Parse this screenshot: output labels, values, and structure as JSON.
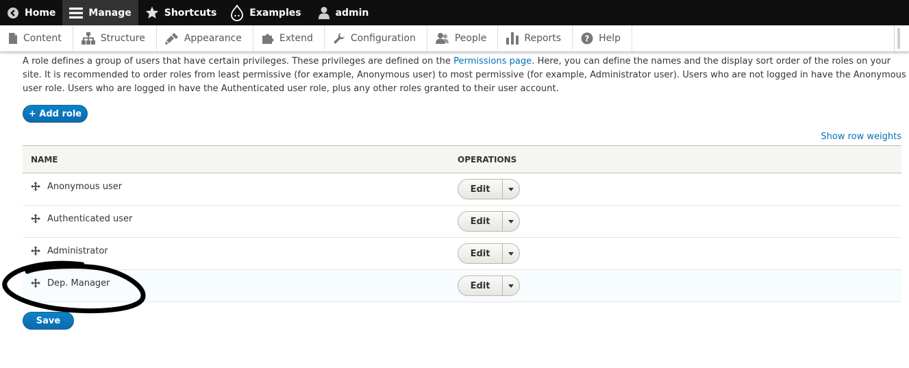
{
  "toolbar": {
    "home": "Home",
    "manage": "Manage",
    "shortcuts": "Shortcuts",
    "examples": "Examples",
    "user": "admin"
  },
  "tray": {
    "items": [
      {
        "label": "Content",
        "icon": "content-icon"
      },
      {
        "label": "Structure",
        "icon": "structure-icon"
      },
      {
        "label": "Appearance",
        "icon": "appearance-icon"
      },
      {
        "label": "Extend",
        "icon": "extend-icon"
      },
      {
        "label": "Configuration",
        "icon": "configuration-icon"
      },
      {
        "label": "People",
        "icon": "people-icon"
      },
      {
        "label": "Reports",
        "icon": "reports-icon"
      },
      {
        "label": "Help",
        "icon": "help-icon"
      }
    ]
  },
  "description": {
    "part1": "A role defines a group of users that have certain privileges. These privileges are defined on the ",
    "link": "Permissions page",
    "part2": ". Here, you can define the names and the display sort order of the roles on your site. It is recommended to order roles from least permissive (for example, Anonymous user) to most permissive (for example, Administrator user). Users who are not logged in have the Anonymous user role. Users who are logged in have the Authenticated user role, plus any other roles granted to their user account."
  },
  "actions": {
    "add_role": "+ Add role",
    "show_row_weights": "Show row weights",
    "save": "Save"
  },
  "table": {
    "headers": {
      "name": "NAME",
      "operations": "OPERATIONS"
    },
    "rows": [
      {
        "name": "Anonymous user",
        "operation": "Edit"
      },
      {
        "name": "Authenticated user",
        "operation": "Edit"
      },
      {
        "name": "Administrator",
        "operation": "Edit"
      },
      {
        "name": "Dep. Manager",
        "operation": "Edit"
      }
    ]
  },
  "colors": {
    "toolbar_bg": "#0f0f0f",
    "link": "#0071b8",
    "primary_button": "#0071b8",
    "annotation": "#000000"
  }
}
